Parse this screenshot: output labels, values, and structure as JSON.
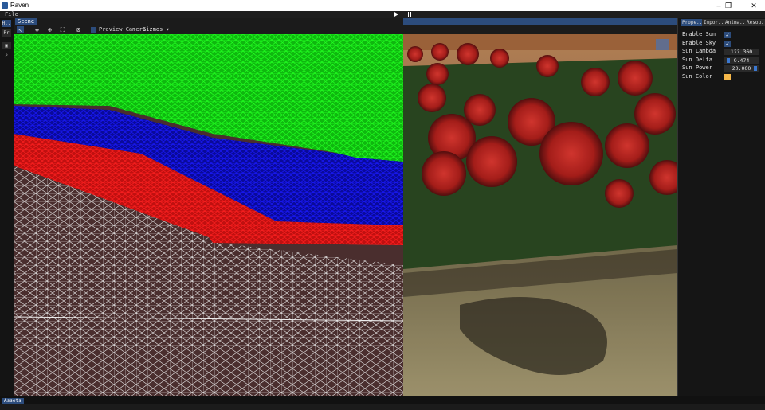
{
  "window": {
    "title": "Raven",
    "minimize_glyph": "–",
    "maximize_glyph": "❐",
    "close_glyph": "✕"
  },
  "menu": {
    "file": "File"
  },
  "playback": {
    "play_icon": "play-icon",
    "pause_icon": "pause-icon"
  },
  "left_tools": {
    "tab1": "H..",
    "tab2": "Pr"
  },
  "scene": {
    "tab_label": "Scene",
    "toolbar": {
      "preview_camera": "Preview Camera",
      "gizmos": "Gizmos ▾"
    }
  },
  "right_panel": {
    "tabs": [
      "Prope..",
      "Impor..",
      "Anima..",
      "Resou.."
    ],
    "properties": {
      "enable_sun_label": "Enable Sun",
      "enable_sky_label": "Enable Sky",
      "sun_lambda_label": "Sun Lambda",
      "sun_lambda_value": "1??.360",
      "sun_delta_label": "Sun Delta",
      "sun_delta_value": "9.474",
      "sun_power_label": "Sun Power",
      "sun_power_value": "20.000",
      "sun_color_label": "Sun Color",
      "sun_color": "#f6b84a"
    }
  },
  "bottom": {
    "assets_tab": "Assets"
  },
  "colors": {
    "accent": "#2c4c7c",
    "slider": "#3b78d0"
  }
}
